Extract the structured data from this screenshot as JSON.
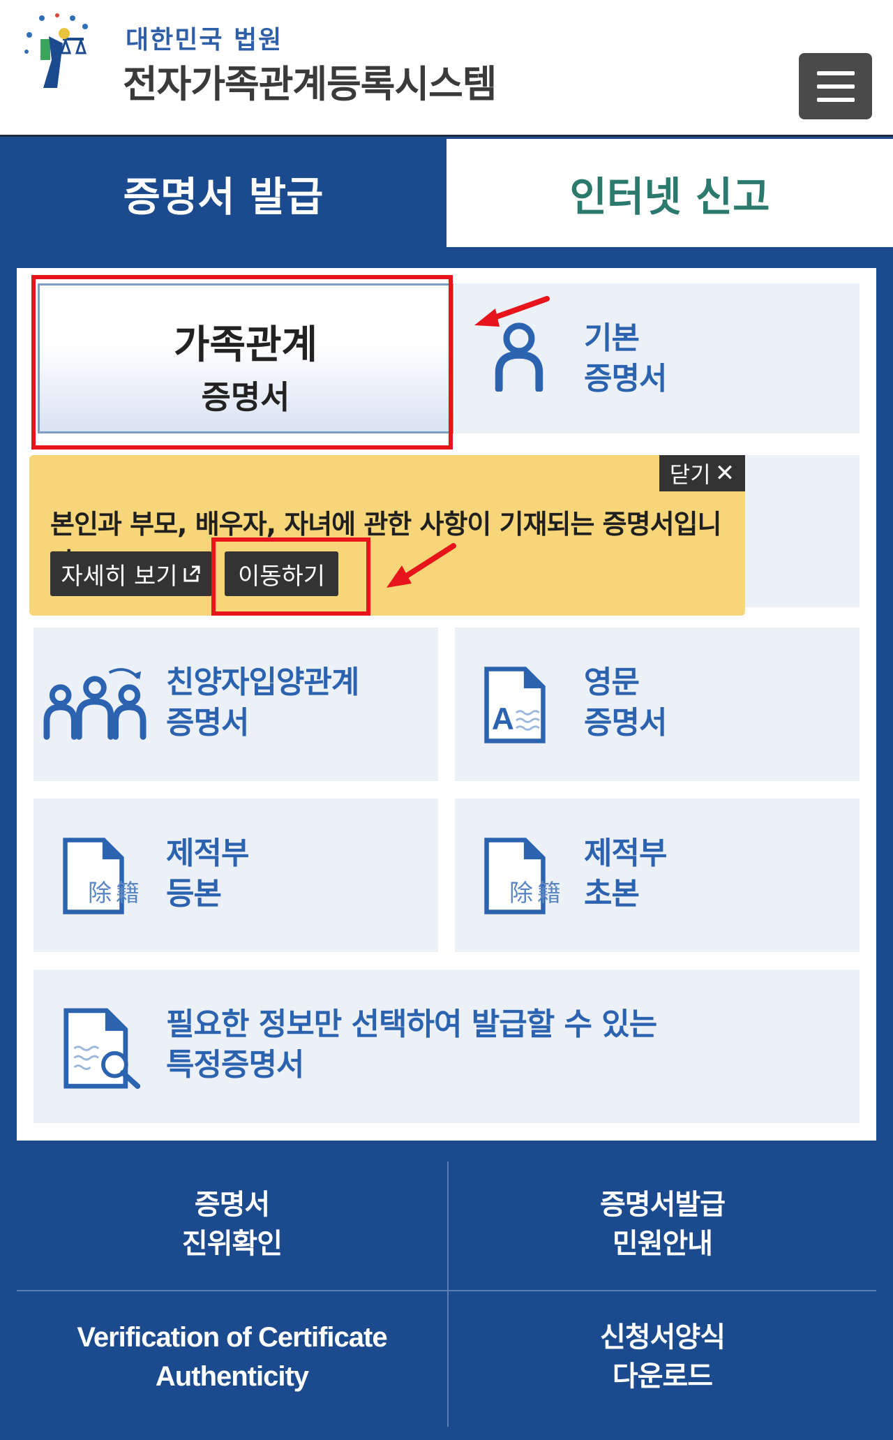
{
  "header": {
    "brand_sub": "대한민국 법원",
    "brand_main": "전자가족관계등록시스템"
  },
  "tabs": [
    {
      "label": "증명서 발급",
      "active": true
    },
    {
      "label": "인터넷 신고",
      "active": false
    }
  ],
  "certificates": {
    "family": {
      "title": "가족관계",
      "subtitle": "증명서"
    },
    "basic": {
      "line1": "기본",
      "line2": "증명서"
    },
    "adoption": {
      "line1": "친양자입양관계",
      "line2": "증명서"
    },
    "english": {
      "line1": "영문",
      "line2": "증명서"
    },
    "removed_copy": {
      "line1": "제적부",
      "line2": "등본",
      "icon_text": "除籍"
    },
    "removed_extract": {
      "line1": "제적부",
      "line2": "초본",
      "icon_text": "除籍"
    },
    "specific": {
      "line1": "필요한 정보만 선택하여 발급할 수 있는",
      "line2": "특정증명서"
    }
  },
  "tooltip": {
    "close_label": "닫기",
    "text": "본인과 부모, 배우자, 자녀에 관한 사항이 기재되는 증명서입니다.",
    "detail_label": "자세히 보기",
    "move_label": "이동하기"
  },
  "bottom_links": {
    "verify": {
      "line1": "증명서",
      "line2": "진위확인"
    },
    "guide": {
      "line1": "증명서발급",
      "line2": "민원안내"
    },
    "verify_en": {
      "line1": "Verification of Certificate",
      "line2": "Authenticity"
    },
    "forms": {
      "line1": "신청서양식",
      "line2": "다운로드"
    }
  },
  "colors": {
    "brand_blue": "#1c4a8f",
    "card_bg": "#ecf1f7",
    "icon_blue": "#2b63b0",
    "tooltip_bg": "#f7d67a",
    "highlight_red": "#e8141b",
    "tab_inactive_text": "#2c7a6e"
  }
}
